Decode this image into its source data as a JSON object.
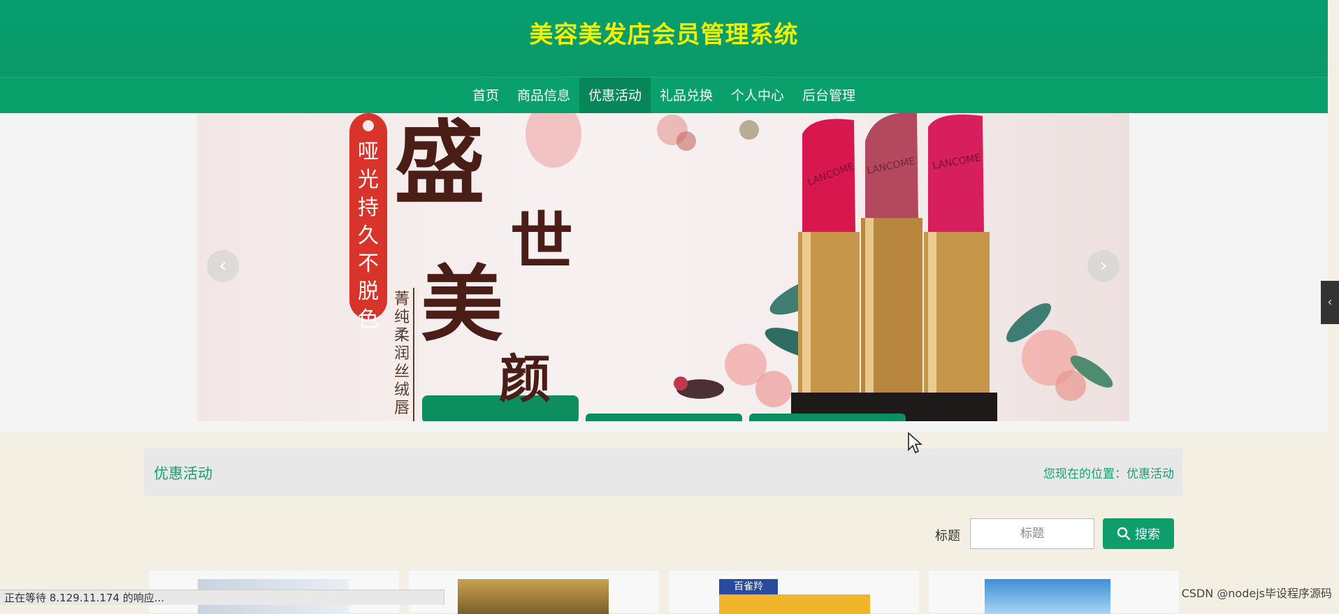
{
  "header": {
    "title": "美容美发店会员管理系统"
  },
  "nav": {
    "items": [
      {
        "label": "首页"
      },
      {
        "label": "商品信息"
      },
      {
        "label": "优惠活动"
      },
      {
        "label": "礼品兑换"
      },
      {
        "label": "个人中心"
      },
      {
        "label": "后台管理"
      }
    ],
    "active_index": 2
  },
  "banner": {
    "tag_vertical": "哑光持久不脱色",
    "headline_1": "盛",
    "headline_2": "世",
    "headline_3": "美",
    "headline_4": "颜",
    "subtext_vertical": "菁纯柔润丝绒唇",
    "lipstick_brand": "LANCOME"
  },
  "section": {
    "title": "优惠活动",
    "breadcrumb": "您现在的位置：优惠活动"
  },
  "search": {
    "label": "标题",
    "placeholder": "标题",
    "button_label": "搜索"
  },
  "cards": [
    {
      "thumb_label": ""
    },
    {
      "thumb_label": ""
    },
    {
      "thumb_label": "百雀羚"
    },
    {
      "thumb_label": ""
    }
  ],
  "status_bar": {
    "text": "正在等待 8.129.11.174 的响应..."
  },
  "watermark": {
    "text": "CSDN @nodejs毕设程序源码"
  },
  "colors": {
    "header_bg": "#069e6e",
    "title_color": "#f2f000",
    "accent": "#17a173",
    "lipstick_red": "#d8174f"
  }
}
